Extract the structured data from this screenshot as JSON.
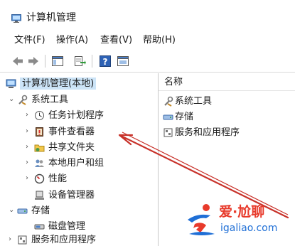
{
  "window": {
    "title": "计算机管理"
  },
  "menu": [
    "文件(F)",
    "操作(A)",
    "查看(V)",
    "帮助(H)"
  ],
  "toolbar": {
    "buttons": [
      "back-icon",
      "forward-icon",
      "show-tree-icon",
      "export-icon",
      "help-icon",
      "properties-icon"
    ]
  },
  "tree": {
    "root": "计算机管理(本地)",
    "system_tools": {
      "label": "系统工具",
      "children": [
        "任务计划程序",
        "事件查看器",
        "共享文件夹",
        "本地用户和组",
        "性能",
        "设备管理器"
      ]
    },
    "storage": {
      "label": "存储",
      "children": [
        "磁盘管理"
      ]
    },
    "services": {
      "label": "服务和应用程序"
    }
  },
  "right_pane": {
    "header": "名称",
    "items": [
      "系统工具",
      "存储",
      "服务和应用程序"
    ]
  },
  "watermark": {
    "title": "爱·尬聊",
    "url": "igaliao.com"
  },
  "colors": {
    "selection": "#cce4f7",
    "annotation_arrow": "#c8322a",
    "watermark_red": "#e83a2b",
    "watermark_blue": "#1f6fd6"
  }
}
